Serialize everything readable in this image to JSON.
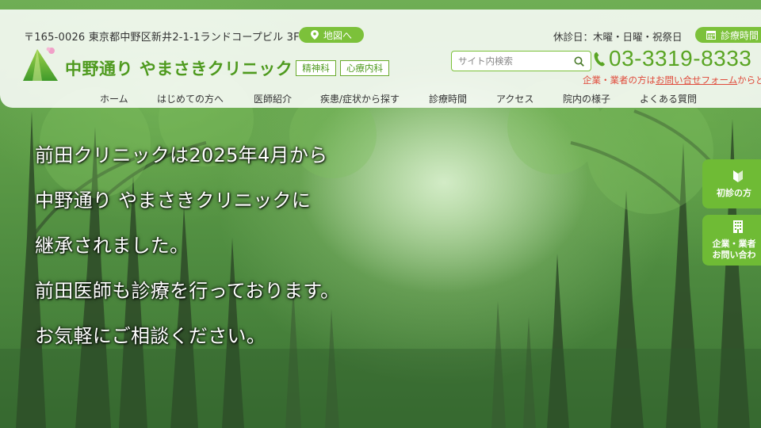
{
  "header": {
    "address": "〒165-0026 東京都中野区新井2-1-1ランドコープビル 3F",
    "map_button": "地図へ",
    "holiday": "休診日：木曜・日曜・祝祭日",
    "hours_button": "診療時間",
    "clinic_name": "中野通り やまさきクリニック",
    "departments": [
      "精神科",
      "心療内科"
    ],
    "search_placeholder": "サイト内検索",
    "phone": "03-3319-8333",
    "contact_note_prefix": "企業・業者の方は",
    "contact_note_link": "お問い合せフォーム",
    "contact_note_suffix": "からど"
  },
  "nav": [
    "ホーム",
    "はじめての方へ",
    "医師紹介",
    "疾患/症状から探す",
    "診療時間",
    "アクセス",
    "院内の様子",
    "よくある質問"
  ],
  "hero": {
    "lines": [
      "前田クリニックは2025年4月から",
      "中野通り やまさきクリニックに",
      "継承されました。",
      "前田医師も診療を行っております。",
      "お気軽にご相談ください。"
    ]
  },
  "side_buttons": {
    "first_visit": "初診の方",
    "business_line1": "企業・業者",
    "business_line2": "お問い合わ"
  },
  "colors": {
    "accent_green": "#7cc13a",
    "brand_green": "#4e9a1e",
    "alert_red": "#e04a3a"
  }
}
